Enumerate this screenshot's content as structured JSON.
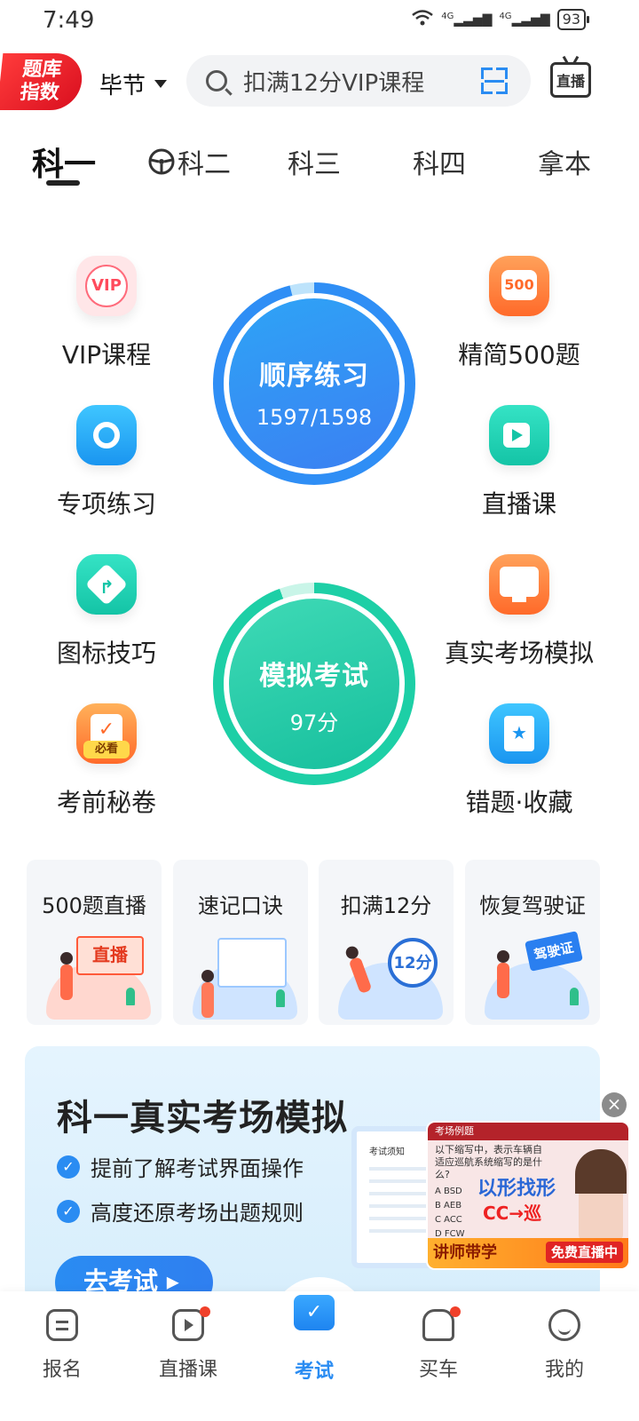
{
  "status": {
    "time": "7:49",
    "signal1": "4G",
    "signal2": "4G",
    "battery": "93"
  },
  "header": {
    "logo_line1": "题库",
    "logo_line2": "指数",
    "city": "毕节",
    "search_placeholder": "扣满12分VIP课程",
    "live_label": "直播"
  },
  "tabs": [
    {
      "label": "科一",
      "active": true
    },
    {
      "label": "科二",
      "active": false
    },
    {
      "label": "科三",
      "active": false
    },
    {
      "label": "科四",
      "active": false
    },
    {
      "label": "拿本",
      "active": false
    }
  ],
  "features": {
    "vip": {
      "label": "VIP课程",
      "icon": "vip-icon",
      "badge": "VIP"
    },
    "simple500": {
      "label": "精简500题",
      "icon": "500-icon",
      "badge": "500"
    },
    "special": {
      "label": "专项练习",
      "icon": "target-icon"
    },
    "live_class": {
      "label": "直播课",
      "icon": "video-icon"
    },
    "sign_tips": {
      "label": "图标技巧",
      "icon": "direction-sign-icon"
    },
    "real_exam": {
      "label": "真实考场模拟",
      "icon": "monitor-icon"
    },
    "secret": {
      "label": "考前秘卷",
      "icon": "secret-paper-icon",
      "badge": "必看"
    },
    "wrong_fav": {
      "label": "错题·收藏",
      "icon": "bookmark-star-icon"
    }
  },
  "order_practice": {
    "title": "顺序练习",
    "progress": "1597/1598",
    "done": 1597,
    "total": 1598
  },
  "mock_exam": {
    "title": "模拟考试",
    "score": "97分"
  },
  "quick_cards": [
    {
      "title": "500题直播",
      "tag": "直播"
    },
    {
      "title": "速记口诀"
    },
    {
      "title": "扣满12分",
      "tag": "12分"
    },
    {
      "title": "恢复驾驶证",
      "tag": "驾驶证"
    }
  ],
  "promo": {
    "title": "科一真实考场模拟",
    "bullets": [
      "提前了解考试界面操作",
      "高度还原考场出题规则"
    ],
    "button": "去考试 ▸",
    "monitor_label": "考试须知"
  },
  "float_video": {
    "header": "考场例题",
    "question": "以下缩写中，表示车辆自适应巡航系统缩写的是什么?",
    "options": [
      "A  BSD",
      "B  AEB",
      "C  ACC",
      "D  FCW"
    ],
    "big1": "以形找形",
    "big2": "CC→巡",
    "footer_left": "讲师带学",
    "footer_right": "免费直播中",
    "close": "×"
  },
  "nav": [
    {
      "label": "报名",
      "icon": "signup-icon",
      "dot": false
    },
    {
      "label": "直播课",
      "icon": "tv-icon",
      "dot": true
    },
    {
      "label": "考试",
      "icon": "exam-folder-icon",
      "dot": false,
      "active": true
    },
    {
      "label": "买车",
      "icon": "car-icon",
      "dot": true
    },
    {
      "label": "我的",
      "icon": "profile-icon",
      "dot": false
    }
  ],
  "colors": {
    "accent": "#2a8cf2",
    "teal": "#16bf9d",
    "orange": "#ff6a2a",
    "red": "#e02424"
  }
}
